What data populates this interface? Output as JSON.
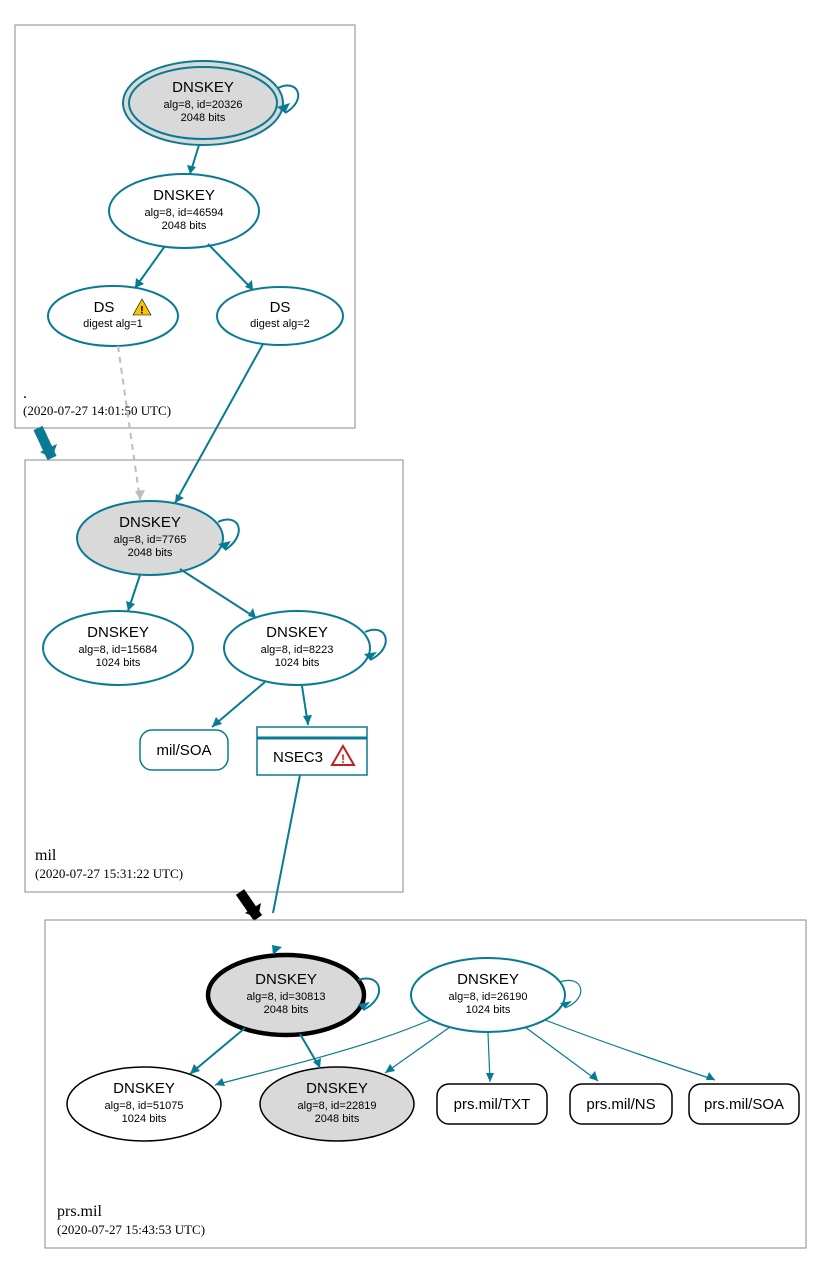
{
  "zones": {
    "root": {
      "label": ".",
      "timestamp": "(2020-07-27 14:01:50 UTC)"
    },
    "mil": {
      "label": "mil",
      "timestamp": "(2020-07-27 15:31:22 UTC)"
    },
    "prs": {
      "label": "prs.mil",
      "timestamp": "(2020-07-27 15:43:53 UTC)"
    }
  },
  "nodes": {
    "root_ksk": {
      "title": "DNSKEY",
      "sub1": "alg=8, id=20326",
      "sub2": "2048 bits"
    },
    "root_zsk": {
      "title": "DNSKEY",
      "sub1": "alg=8, id=46594",
      "sub2": "2048 bits"
    },
    "ds1": {
      "title": "DS",
      "sub": "digest alg=1"
    },
    "ds2": {
      "title": "DS",
      "sub": "digest alg=2"
    },
    "mil_ksk": {
      "title": "DNSKEY",
      "sub1": "alg=8, id=7765",
      "sub2": "2048 bits"
    },
    "mil_zsk1": {
      "title": "DNSKEY",
      "sub1": "alg=8, id=15684",
      "sub2": "1024 bits"
    },
    "mil_zsk2": {
      "title": "DNSKEY",
      "sub1": "alg=8, id=8223",
      "sub2": "1024 bits"
    },
    "mil_soa": {
      "label": "mil/SOA"
    },
    "nsec3": {
      "label": "NSEC3"
    },
    "prs_ksk": {
      "title": "DNSKEY",
      "sub1": "alg=8, id=30813",
      "sub2": "2048 bits"
    },
    "prs_zsk1": {
      "title": "DNSKEY",
      "sub1": "alg=8, id=26190",
      "sub2": "1024 bits"
    },
    "prs_key3": {
      "title": "DNSKEY",
      "sub1": "alg=8, id=51075",
      "sub2": "1024 bits"
    },
    "prs_key4": {
      "title": "DNSKEY",
      "sub1": "alg=8, id=22819",
      "sub2": "2048 bits"
    },
    "prs_txt": {
      "label": "prs.mil/TXT"
    },
    "prs_ns": {
      "label": "prs.mil/NS"
    },
    "prs_soa": {
      "label": "prs.mil/SOA"
    }
  }
}
